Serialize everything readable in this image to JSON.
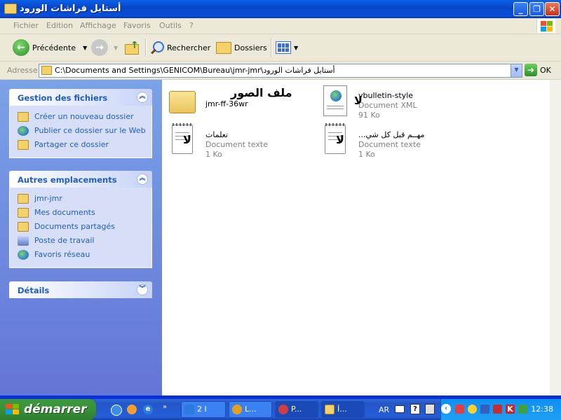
{
  "window": {
    "title": "أستايل فراشات الورود"
  },
  "menu": {
    "items": [
      "Fichier",
      "Edition",
      "Affichage",
      "Favoris",
      "Outils",
      "?"
    ]
  },
  "toolbar": {
    "back": "Précédente",
    "search": "Rechercher",
    "folders": "Dossiers"
  },
  "address": {
    "label": "Adresse",
    "value": "C:\\Documents and Settings\\GENICOM\\Bureau\\jmr-jmr\\أستايل فراشات الورود",
    "go": "OK"
  },
  "sidebar": {
    "tasks": {
      "title": "Gestion des fichiers",
      "items": [
        "Créer un nouveau dossier",
        "Publier ce dossier sur le Web",
        "Partager ce dossier"
      ]
    },
    "places": {
      "title": "Autres emplacements",
      "items": [
        "jmr-jmr",
        "Mes documents",
        "Documents partagés",
        "Poste de travail",
        "Favoris réseau"
      ]
    },
    "details": {
      "title": "Détails"
    }
  },
  "files": [
    {
      "name": "jmr-ff-36wr",
      "type": "",
      "size": "",
      "icon": "folder-icon",
      "overlay": "ملف الصور"
    },
    {
      "name": "vbulletin-style",
      "type": "Document XML",
      "size": "91 Ko",
      "icon": "xml-document-icon",
      "overlay": "لا"
    },
    {
      "name": "تعلمات",
      "type": "Document texte",
      "size": "1 Ko",
      "icon": "text-document-icon",
      "overlay": "لا"
    },
    {
      "name": "...مهــم قبل كل شي",
      "type": "Document texte",
      "size": "1 Ko",
      "icon": "text-document-icon",
      "overlay": "لا"
    }
  ],
  "taskbar": {
    "start": "démarrer",
    "tasks": [
      "2 I",
      "L...",
      "P...",
      "Í..."
    ],
    "language": "AR",
    "clock": "12:38"
  },
  "colors": {
    "accent": "#215dc6",
    "taskbar": "#245ed8",
    "start": "#3a8f3a"
  }
}
